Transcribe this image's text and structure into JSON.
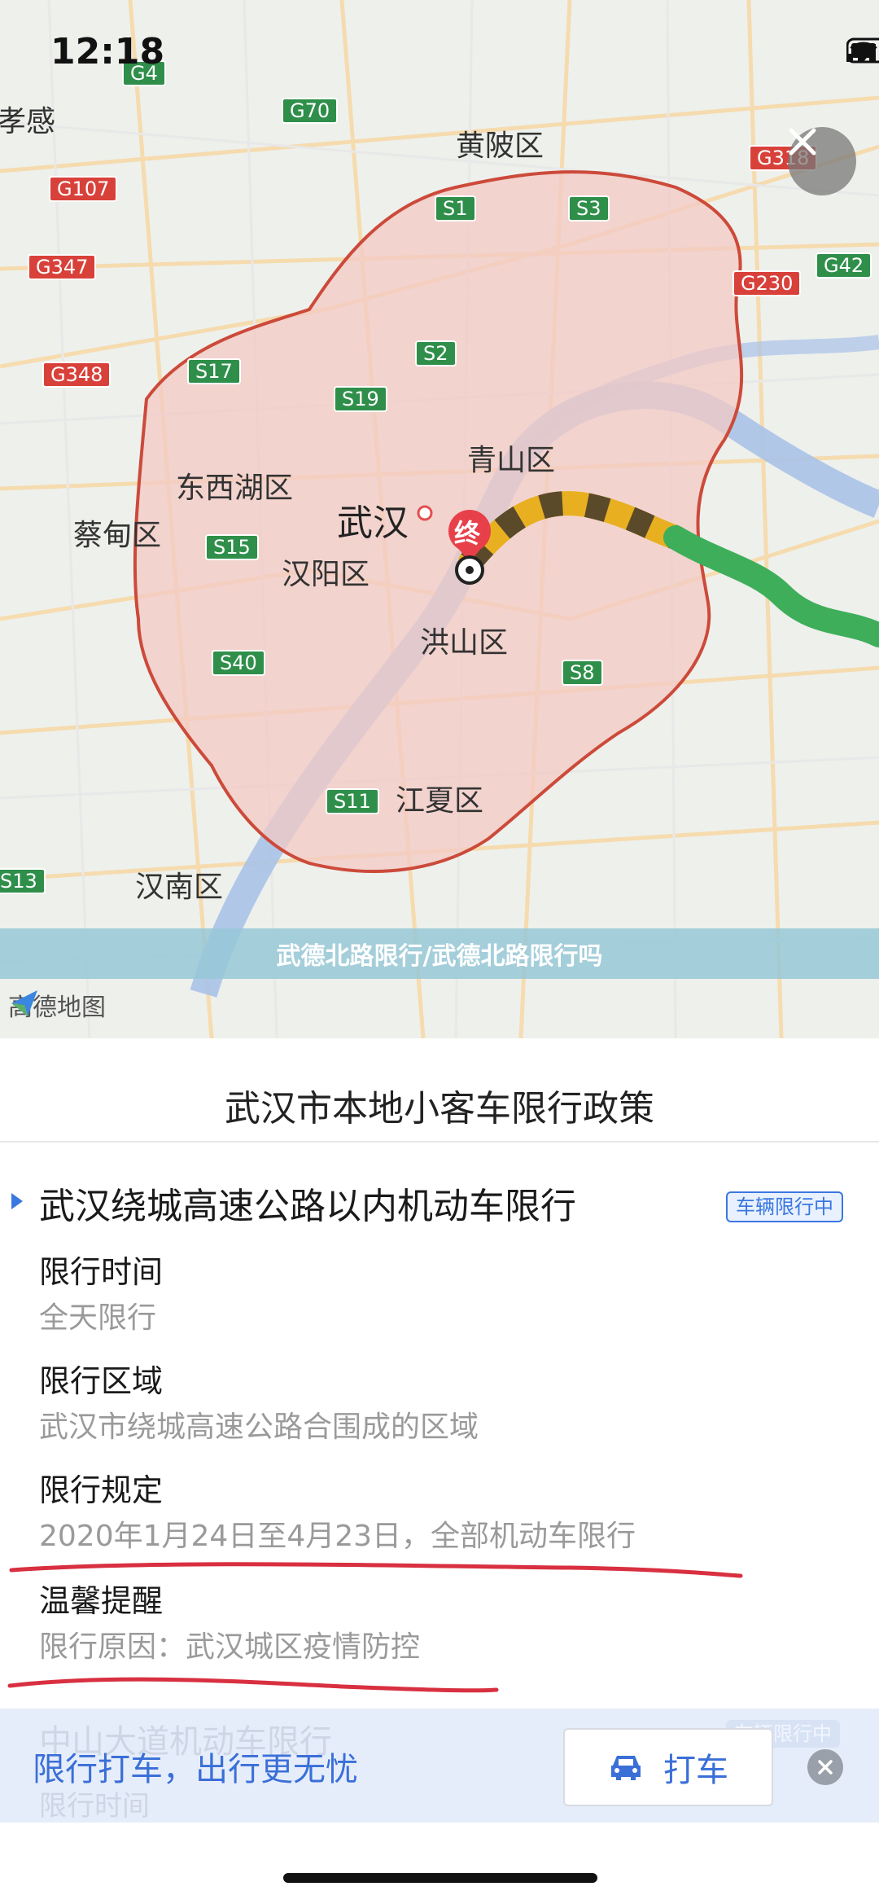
{
  "status_bar": {
    "time": "12:18"
  },
  "map": {
    "districts": [
      "黄陂区",
      "青山区",
      "东西湖区",
      "蔡甸区",
      "汉阳区",
      "洪山区",
      "江夏区",
      "汉南区",
      "孝感"
    ],
    "city_label": "武汉",
    "destination_marker": "终",
    "highways": [
      "G4",
      "G70",
      "G107",
      "G347",
      "G348",
      "G318",
      "G42",
      "G230",
      "S1",
      "S3",
      "S2",
      "S17",
      "S19",
      "S15",
      "S40",
      "S8",
      "S11",
      "S13"
    ],
    "brand": "高德地图",
    "colors": {
      "restricted_area": "#f3c9c4",
      "border": "#cc4a3a",
      "traffic_jam": "#e8b020",
      "traffic_clear": "#3fae5a",
      "river": "#a9c2e8"
    }
  },
  "overlay_banner": "武德北路限行/武德北路限行吗",
  "sheet": {
    "title": "武汉市本地小客车限行政策",
    "rule": {
      "title": "武汉绕城高速公路以内机动车限行",
      "badge": "车辆限行中",
      "fields": [
        {
          "label": "限行时间",
          "value": "全天限行"
        },
        {
          "label": "限行区域",
          "value": "武汉市绕城高速公路合围成的区域"
        },
        {
          "label": "限行规定",
          "value": "2020年1月24日至4月23日，全部机动车限行"
        },
        {
          "label": "温馨提醒",
          "value": "限行原因：武汉城区疫情防控"
        }
      ]
    },
    "next_rule_partial": {
      "title": "中山大道机动车限行",
      "badge": "车辆限行中",
      "subtitle": "限行时间"
    }
  },
  "cta": {
    "text": "限行打车，出行更无忧",
    "button_label": "打车"
  }
}
